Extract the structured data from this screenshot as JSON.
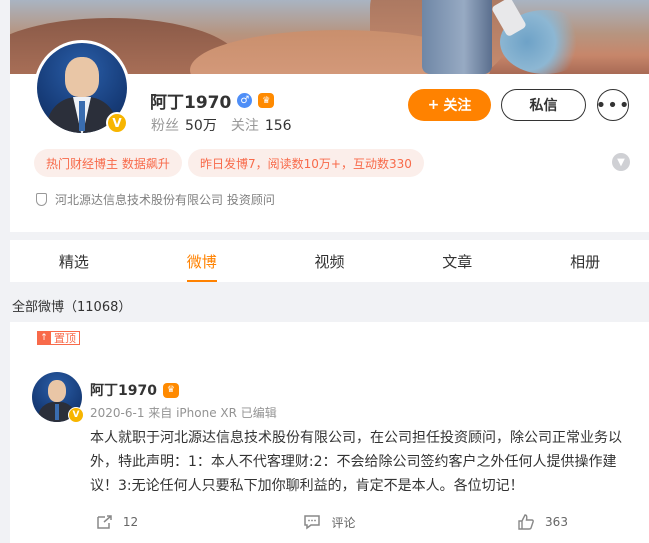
{
  "profile": {
    "name": "阿丁1970",
    "gender_icon": "male-icon",
    "crown_icon": "crown-icon",
    "verified_badge": "V",
    "fans_label": "粉丝",
    "fans_value": "50万",
    "following_label": "关注",
    "following_value": "156",
    "follow_button": "关注",
    "follow_plus": "+",
    "message_button": "私信",
    "more_button": "•••",
    "tags": [
      "热门财经博主 数据飙升",
      "昨日发博7，阅读数10万+，互动数330"
    ],
    "expand_icon": "chevron-down-icon",
    "company": "河北源达信息技术股份有限公司 投资顾问"
  },
  "tabs": [
    "精选",
    "微博",
    "视频",
    "文章",
    "相册"
  ],
  "active_tab": "微博",
  "weibo_count": "全部微博（11068）",
  "post": {
    "pin_label": "置顶",
    "pin_icon": "↑",
    "author": "阿丁1970",
    "meta": "2020-6-1  来自 iPhone XR  已编辑",
    "text": "本人就职于河北源达信息技术股份有限公司，在公司担任投资顾问，除公司正常业务以外，特此声明：1：本人不代客理财:2：不会给除公司签约客户之外任何人提供操作建议！3:无论任何人只要私下加你聊利益的，肯定不是本人。各位切记！",
    "repost_count": "12",
    "comment_label": "评论",
    "like_count": "363"
  },
  "colors": {
    "accent": "#ff8200",
    "tag_bg": "#fbeeea",
    "tag_text": "#f86a4a"
  }
}
